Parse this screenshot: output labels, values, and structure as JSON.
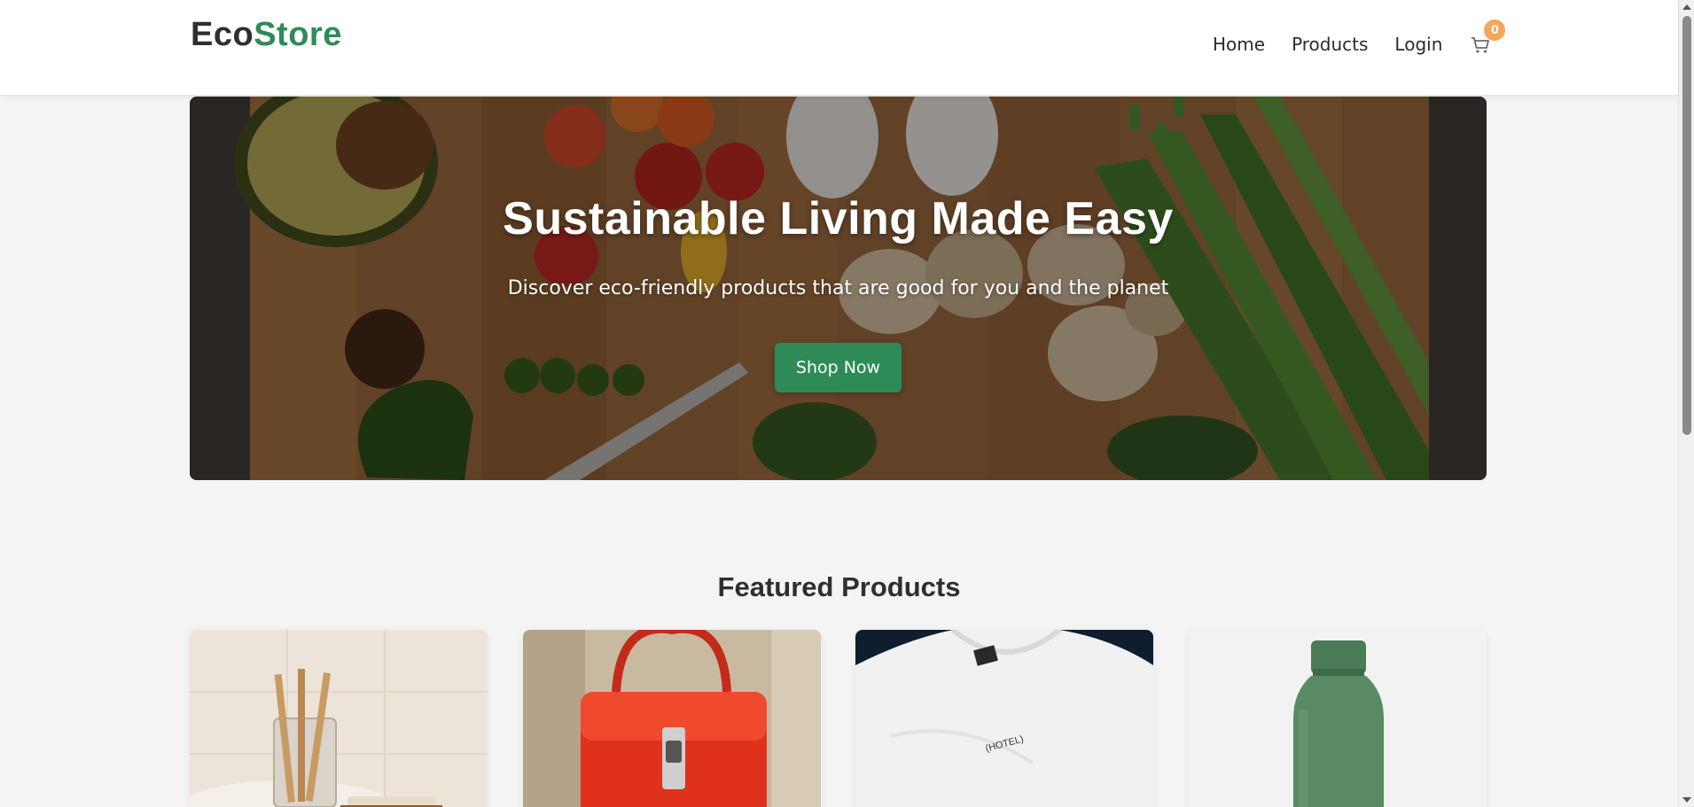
{
  "header": {
    "logo_part1": "Eco",
    "logo_part2": "Store",
    "nav": [
      "Home",
      "Products",
      "Login"
    ],
    "cart_icon": "cart-icon",
    "cart_count": "0"
  },
  "hero": {
    "title": "Sustainable Living Made Easy",
    "subtitle": "Discover eco-friendly products that are good for you and the planet",
    "cta_label": "Shop Now"
  },
  "featured": {
    "title": "Featured Products",
    "products": [
      {
        "image": "bamboo-toothbrushes-image"
      },
      {
        "image": "red-handbag-image"
      },
      {
        "image": "white-tshirt-image",
        "print_text": "(HOTEL)"
      },
      {
        "image": "green-water-bottle-image"
      }
    ]
  },
  "colors": {
    "brand_green": "#2e8b57",
    "badge_orange": "#f2a65a",
    "background": "#f4f4f4"
  }
}
